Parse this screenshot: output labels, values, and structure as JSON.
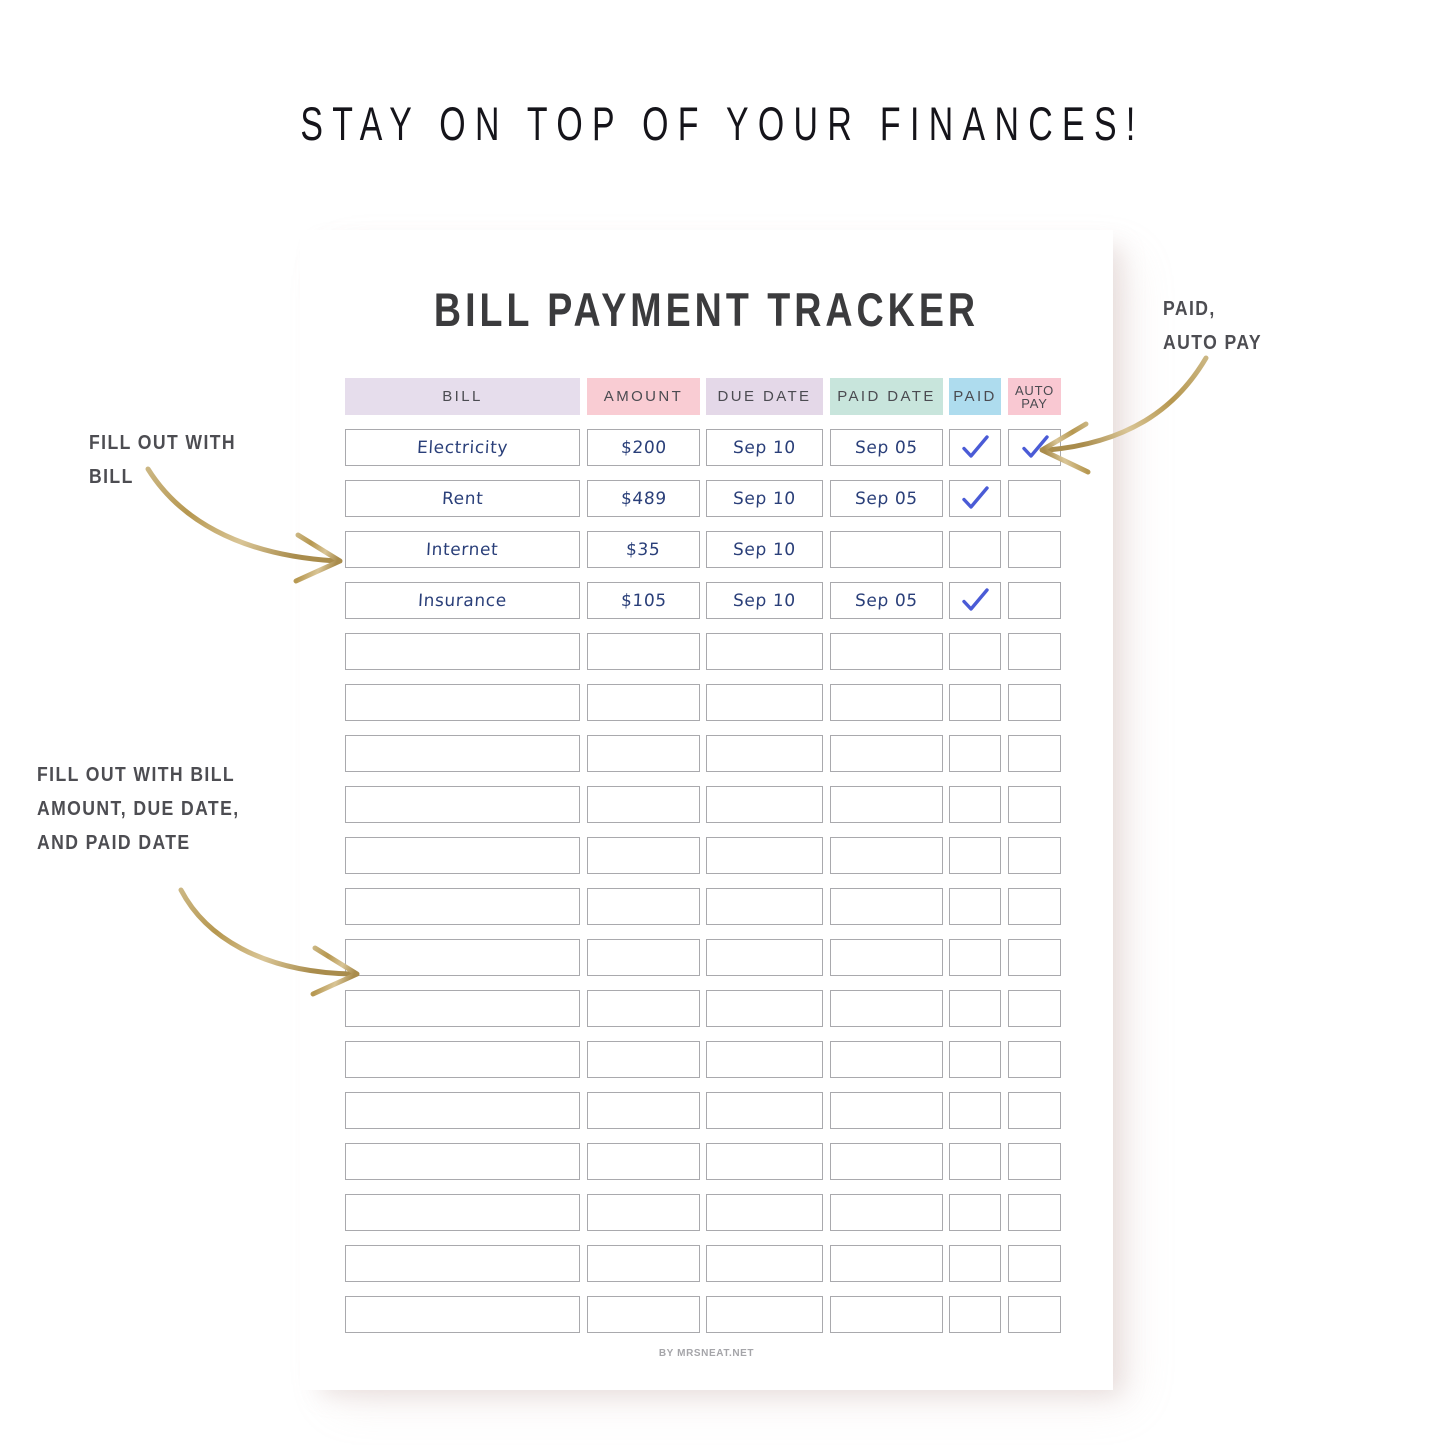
{
  "banner": {
    "title": "STAY ON TOP OF YOUR FINANCES!"
  },
  "sheet": {
    "title": "BILL PAYMENT TRACKER",
    "credit": "BY MRSNEAT.NET"
  },
  "table": {
    "headers": [
      {
        "key": "bill",
        "label": "BILL",
        "color": "#e6ddec"
      },
      {
        "key": "amount",
        "label": "AMOUNT",
        "color": "#f9ccd3"
      },
      {
        "key": "due_date",
        "label": "DUE DATE",
        "color": "#e4d8e8"
      },
      {
        "key": "paid_date",
        "label": "PAID DATE",
        "color": "#c8e5dc"
      },
      {
        "key": "paid",
        "label": "PAID",
        "color": "#aedcee"
      },
      {
        "key": "auto_pay",
        "label_line1": "AUTO",
        "label_line2": "PAY",
        "color": "#f9c8d2"
      }
    ],
    "total_rows": 18,
    "rows": [
      {
        "bill": "Electricity",
        "amount": "$200",
        "due_date": "Sep 10",
        "paid_date": "Sep 05",
        "paid": true,
        "auto_pay": true
      },
      {
        "bill": "Rent",
        "amount": "$489",
        "due_date": "Sep 10",
        "paid_date": "Sep 05",
        "paid": true,
        "auto_pay": false
      },
      {
        "bill": "Internet",
        "amount": "$35",
        "due_date": "Sep 10",
        "paid_date": "",
        "paid": false,
        "auto_pay": false
      },
      {
        "bill": "Insurance",
        "amount": "$105",
        "due_date": "Sep 10",
        "paid_date": "Sep 05",
        "paid": true,
        "auto_pay": false
      },
      {
        "bill": "",
        "amount": "",
        "due_date": "",
        "paid_date": "",
        "paid": false,
        "auto_pay": false
      },
      {
        "bill": "",
        "amount": "",
        "due_date": "",
        "paid_date": "",
        "paid": false,
        "auto_pay": false
      },
      {
        "bill": "",
        "amount": "",
        "due_date": "",
        "paid_date": "",
        "paid": false,
        "auto_pay": false
      },
      {
        "bill": "",
        "amount": "",
        "due_date": "",
        "paid_date": "",
        "paid": false,
        "auto_pay": false
      },
      {
        "bill": "",
        "amount": "",
        "due_date": "",
        "paid_date": "",
        "paid": false,
        "auto_pay": false
      },
      {
        "bill": "",
        "amount": "",
        "due_date": "",
        "paid_date": "",
        "paid": false,
        "auto_pay": false
      },
      {
        "bill": "",
        "amount": "",
        "due_date": "",
        "paid_date": "",
        "paid": false,
        "auto_pay": false
      },
      {
        "bill": "",
        "amount": "",
        "due_date": "",
        "paid_date": "",
        "paid": false,
        "auto_pay": false
      },
      {
        "bill": "",
        "amount": "",
        "due_date": "",
        "paid_date": "",
        "paid": false,
        "auto_pay": false
      },
      {
        "bill": "",
        "amount": "",
        "due_date": "",
        "paid_date": "",
        "paid": false,
        "auto_pay": false
      },
      {
        "bill": "",
        "amount": "",
        "due_date": "",
        "paid_date": "",
        "paid": false,
        "auto_pay": false
      },
      {
        "bill": "",
        "amount": "",
        "due_date": "",
        "paid_date": "",
        "paid": false,
        "auto_pay": false
      },
      {
        "bill": "",
        "amount": "",
        "due_date": "",
        "paid_date": "",
        "paid": false,
        "auto_pay": false
      },
      {
        "bill": "",
        "amount": "",
        "due_date": "",
        "paid_date": "",
        "paid": false,
        "auto_pay": false
      }
    ]
  },
  "annotations": {
    "fill_bill": "FILL OUT WITH\nBILL",
    "fill_details": "FILL OUT WITH BILL\nAMOUNT, DUE DATE,\nAND PAID DATE",
    "paid_autopay": "PAID,\nAUTO PAY"
  },
  "colors": {
    "check_blue": "#4a5bd6",
    "handwriting_navy": "#2a3f79",
    "arrow_gold": "#b79b63",
    "cell_border": "#a9a9ad",
    "annotation_text": "#4d4d52"
  }
}
